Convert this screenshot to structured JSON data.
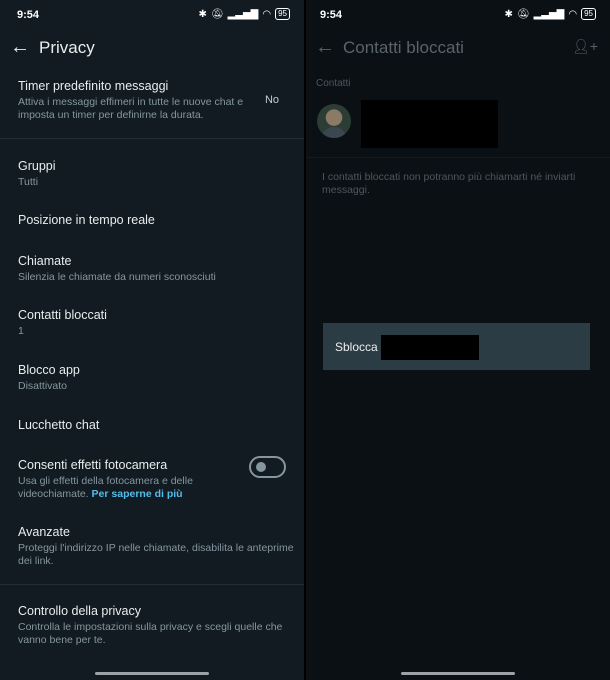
{
  "status": {
    "time": "9:54",
    "battery": "95"
  },
  "left": {
    "title": "Privacy",
    "items": [
      {
        "title": "Timer predefinito messaggi",
        "subtitle": "Attiva i messaggi effimeri in tutte le nuove chat e imposta un timer per definirne la durata.",
        "value": "No"
      },
      {
        "title": "Gruppi",
        "subtitle": "Tutti"
      },
      {
        "title": "Posizione in tempo reale"
      },
      {
        "title": "Chiamate",
        "subtitle": "Silenzia le chiamate da numeri sconosciuti"
      },
      {
        "title": "Contatti bloccati",
        "subtitle": "1"
      },
      {
        "title": "Blocco app",
        "subtitle": "Disattivato"
      },
      {
        "title": "Lucchetto chat"
      },
      {
        "title": "Consenti effetti fotocamera",
        "subtitle": "Usa gli effetti della fotocamera e delle videochiamate.",
        "link": "Per saperne di più",
        "toggle": "off"
      },
      {
        "title": "Avanzate",
        "subtitle": "Proteggi l'indirizzo IP nelle chiamate, disabilita le anteprime dei link."
      },
      {
        "title": "Controllo della privacy",
        "subtitle": "Controlla le impostazioni sulla privacy e scegli quelle che vanno bene per te."
      }
    ]
  },
  "right": {
    "title": "Contatti bloccati",
    "section_label": "Contatti",
    "note": "I contatti bloccati non potranno più chiamarti né inviarti messaggi.",
    "popup_label": "Sblocca"
  },
  "icons": {
    "back": "arrow-left-icon",
    "add_contact": "person-add-icon",
    "wifi": "wifi-icon",
    "bluetooth": "bluetooth-icon",
    "signal": "signal-icon",
    "battery": "battery-icon",
    "mute": "mute-icon"
  },
  "colors": {
    "link": "#53bdeb",
    "bg_left": "#111b21",
    "popup": "#2c3c44"
  }
}
